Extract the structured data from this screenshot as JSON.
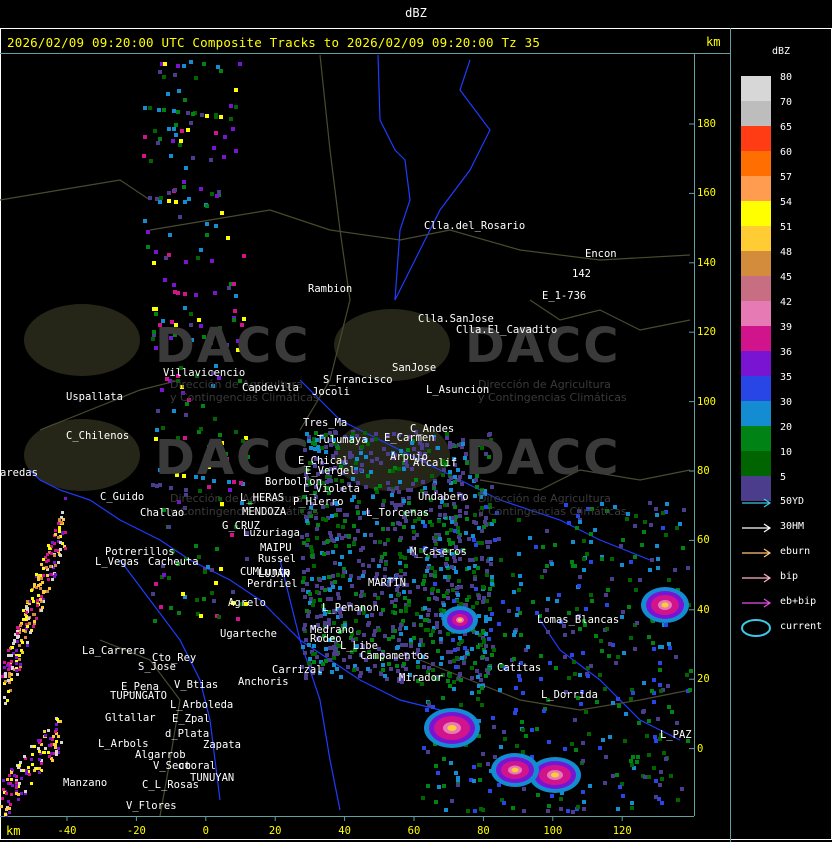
{
  "window": {
    "title": "dBZ"
  },
  "header": {
    "text": "2026/02/09 09:20:00 UTC Composite Tracks to 2026/02/09 09:20:00 Tz 35",
    "unit_top": "km",
    "unit_bottom": "km"
  },
  "legend": {
    "title": "dBZ",
    "entries": [
      {
        "value": "80",
        "color": "#d7d7d7"
      },
      {
        "value": "70",
        "color": "#bdbdbd"
      },
      {
        "value": "65",
        "color": "#ff3c14"
      },
      {
        "value": "60",
        "color": "#ff6e00"
      },
      {
        "value": "57",
        "color": "#ff9c50"
      },
      {
        "value": "54",
        "color": "#ffff00"
      },
      {
        "value": "51",
        "color": "#ffcc33"
      },
      {
        "value": "48",
        "color": "#d28c3c"
      },
      {
        "value": "45",
        "color": "#c86e82"
      },
      {
        "value": "42",
        "color": "#e67ab4"
      },
      {
        "value": "39",
        "color": "#d2148c"
      },
      {
        "value": "36",
        "color": "#7814d2"
      },
      {
        "value": "35",
        "color": "#2846e6"
      },
      {
        "value": "30",
        "color": "#148cd2"
      },
      {
        "value": "20",
        "color": "#008214"
      },
      {
        "value": "10",
        "color": "#006400"
      },
      {
        "value": "5",
        "color": "#4b3c8c"
      }
    ],
    "tracks": [
      {
        "label": "50YD",
        "color": "#3cc8e6"
      },
      {
        "label": "30HM",
        "color": "#ffffff"
      },
      {
        "label": "eburn",
        "color": "#ffc878"
      },
      {
        "label": "bip",
        "color": "#ffb4c8"
      },
      {
        "label": "eb+bip",
        "color": "#e650e6"
      },
      {
        "label": "current",
        "color": "#3cc8e6"
      }
    ]
  },
  "axes": {
    "y_ticks": [
      "180",
      "160",
      "140",
      "120",
      "100",
      "80",
      "60",
      "40",
      "20",
      "0"
    ],
    "x_ticks": [
      "-40",
      "-20",
      "0",
      "20",
      "40",
      "60",
      "80",
      "100",
      "120"
    ]
  },
  "watermark": {
    "brand": "DACC",
    "line1": "Dirección de Agricultura",
    "line2": "y Contingencias Climáticas"
  },
  "places": [
    {
      "name": "Clla.del_Rosario"
    },
    {
      "name": "Encon"
    },
    {
      "name": "142"
    },
    {
      "name": "E_1-736"
    },
    {
      "name": "Rambion"
    },
    {
      "name": "Clla.SanJose"
    },
    {
      "name": "Clla.El_Cavadito"
    },
    {
      "name": "Villavicencio"
    },
    {
      "name": "Capdevila"
    },
    {
      "name": "S_Francisco"
    },
    {
      "name": "Jocoli"
    },
    {
      "name": "SanJose"
    },
    {
      "name": "L_Asuncion"
    },
    {
      "name": "Uspallata"
    },
    {
      "name": "Tres_Ma"
    },
    {
      "name": "C_Andes"
    },
    {
      "name": "E_Carmen"
    },
    {
      "name": "C_Chilenos"
    },
    {
      "name": "Tulumaya"
    },
    {
      "name": "Arpujo"
    },
    {
      "name": "Alcalif"
    },
    {
      "name": "E_Chical"
    },
    {
      "name": "E_Vergel"
    },
    {
      "name": "aredas"
    },
    {
      "name": "Borbollon"
    },
    {
      "name": "C_Guido"
    },
    {
      "name": "L_HERAS"
    },
    {
      "name": "L_Violeta"
    },
    {
      "name": "P_Hierro"
    },
    {
      "name": "Undabero"
    },
    {
      "name": "Challao"
    },
    {
      "name": "MENDOZA"
    },
    {
      "name": "L_Torcenas"
    },
    {
      "name": "G_CRUZ"
    },
    {
      "name": "Luzuriaga"
    },
    {
      "name": "Potrerillos"
    },
    {
      "name": "MAIPU"
    },
    {
      "name": "L_Vegas"
    },
    {
      "name": "Cacheuta"
    },
    {
      "name": "Russel"
    },
    {
      "name": "LUJAN"
    },
    {
      "name": "CUMLunta"
    },
    {
      "name": "M_Caseros"
    },
    {
      "name": "Perdriel"
    },
    {
      "name": "MARTIN"
    },
    {
      "name": "Agrelo"
    },
    {
      "name": "L_Penanon"
    },
    {
      "name": "Medrano"
    },
    {
      "name": "Rodeo"
    },
    {
      "name": "L_Libe"
    },
    {
      "name": "Ugarteche"
    },
    {
      "name": "Lomas_Blancas"
    },
    {
      "name": "La_Carrera"
    },
    {
      "name": "Cto_Rey"
    },
    {
      "name": "S_Jose"
    },
    {
      "name": "Carrizal"
    },
    {
      "name": "Campamentos"
    },
    {
      "name": "Catitas"
    },
    {
      "name": "E_Pena"
    },
    {
      "name": "TUPUNGATO"
    },
    {
      "name": "V_Btias"
    },
    {
      "name": "Anchoris"
    },
    {
      "name": "Mirador"
    },
    {
      "name": "L_Dorrida"
    },
    {
      "name": "L_Arboleda"
    },
    {
      "name": "Gltallar"
    },
    {
      "name": "E_Zpal"
    },
    {
      "name": "d_Plata"
    },
    {
      "name": "L_PAZ"
    },
    {
      "name": "L_Arbols"
    },
    {
      "name": "Zapata"
    },
    {
      "name": "V_Seco"
    },
    {
      "name": "otoral"
    },
    {
      "name": "TUNUYAN"
    },
    {
      "name": "Manzano"
    },
    {
      "name": "C_L_Rosas"
    },
    {
      "name": "V_Flores"
    },
    {
      "name": "Algarrob"
    }
  ]
}
